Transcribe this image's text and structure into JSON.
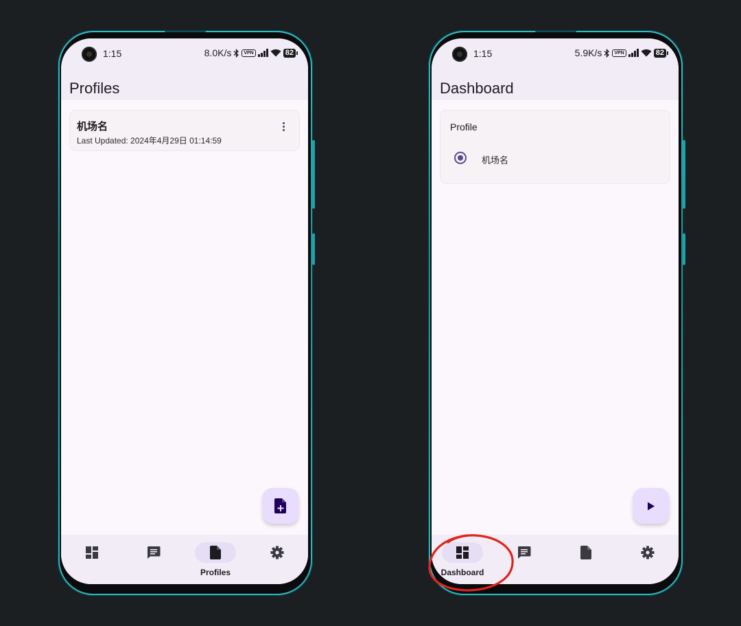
{
  "left_phone": {
    "status": {
      "time": "1:15",
      "net_speed": "8.0K/s",
      "vpn": "VPN",
      "battery": "82"
    },
    "title": "Profiles",
    "profile_card": {
      "name": "机场名",
      "last_updated": "Last Updated: 2024年4月29日 01:14:59",
      "menu_icon": "more-vert-icon"
    },
    "fab_icon": "add-file-icon",
    "nav": [
      {
        "icon": "dashboard-icon",
        "label": "",
        "active": false
      },
      {
        "icon": "message-icon",
        "label": "",
        "active": false
      },
      {
        "icon": "file-icon",
        "label": "Profiles",
        "active": true
      },
      {
        "icon": "gear-icon",
        "label": "",
        "active": false
      }
    ]
  },
  "right_phone": {
    "status": {
      "time": "1:15",
      "net_speed": "5.9K/s",
      "vpn": "VPN",
      "battery": "82"
    },
    "title": "Dashboard",
    "profile_card": {
      "heading": "Profile",
      "option": "机场名",
      "selected": true
    },
    "fab_icon": "play-icon",
    "nav": [
      {
        "icon": "dashboard-icon",
        "label": "Dashboard",
        "active": true
      },
      {
        "icon": "message-icon",
        "label": "",
        "active": false
      },
      {
        "icon": "file-icon",
        "label": "",
        "active": false
      },
      {
        "icon": "gear-icon",
        "label": "",
        "active": false
      }
    ]
  },
  "colors": {
    "background": "#1b1f22",
    "frame_accent": "#2fc0c8",
    "surface": "#fcf7fd",
    "bar": "#f2ecf6",
    "accent": "#5b4a8f",
    "fab": "#e9ddfd",
    "annotation": "#e0241c"
  }
}
